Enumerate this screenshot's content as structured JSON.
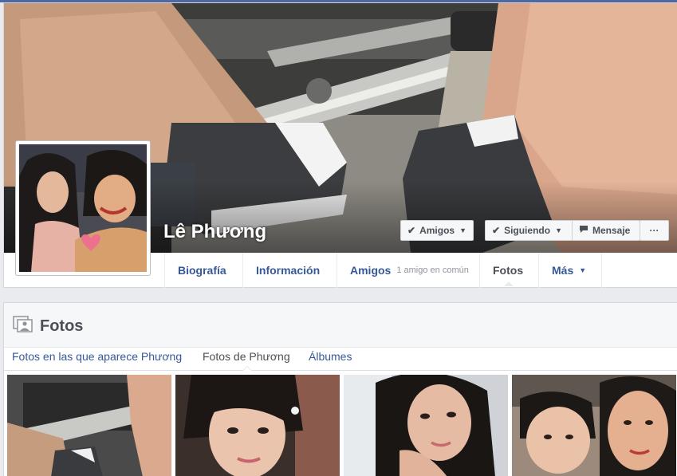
{
  "profile": {
    "name": "Lê Phương"
  },
  "actions": {
    "friends_label": "Amigos",
    "following_label": "Siguiendo",
    "message_label": "Mensaje",
    "more_label": "···"
  },
  "nav": {
    "timeline": "Biografía",
    "about": "Información",
    "friends": "Amigos",
    "friends_mutual": "1 amigo en común",
    "photos": "Fotos",
    "more": "Más"
  },
  "photos_section": {
    "title": "Fotos",
    "tabs": [
      {
        "label": "Fotos en las que aparece Phương"
      },
      {
        "label": "Fotos de Phương"
      },
      {
        "label": "Álbumes"
      }
    ],
    "active_tab": "Fotos de Phương"
  },
  "colors": {
    "link_blue": "#365899",
    "text_dark": "#4b4f56",
    "page_bg": "#e9ebee",
    "top_bar": "#4e69a2"
  },
  "icons": {
    "friends": "check-icon",
    "following": "check-icon",
    "message": "message-icon",
    "more": "ellipsis-icon",
    "photos_header": "photos-icon",
    "dropdown": "caret-down-icon"
  }
}
